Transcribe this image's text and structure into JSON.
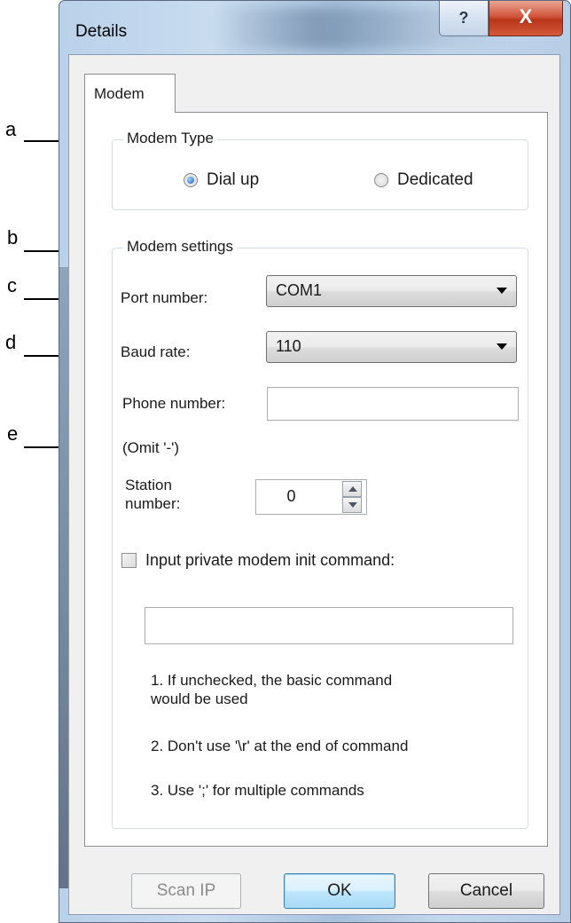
{
  "annotations": [
    "a",
    "b",
    "c",
    "d",
    "e"
  ],
  "window": {
    "title": "Details",
    "help_glyph": "?",
    "close_glyph": "X"
  },
  "tabs": [
    {
      "label": "Modem",
      "selected": true
    }
  ],
  "modem_type": {
    "legend": "Modem Type",
    "options": [
      {
        "label": "Dial up",
        "selected": true
      },
      {
        "label": "Dedicated",
        "selected": false
      }
    ]
  },
  "modem_settings": {
    "legend": "Modem settings",
    "port_label": "Port number:",
    "port_value": "COM1",
    "baud_label": "Baud rate:",
    "baud_value": "110",
    "phone_label": "Phone number:",
    "phone_value": "",
    "omit_hint": "(Omit '-')",
    "station_label_line1": "Station",
    "station_label_line2": "number:",
    "station_value": "0",
    "private_init_label": "Input private modem init command:",
    "private_init_checked": false,
    "private_init_value": "",
    "notes": [
      "1. If unchecked, the basic command",
      "would be used",
      "2. Don't use '\\r' at the end of command",
      "3. Use ';' for multiple commands"
    ]
  },
  "buttons": {
    "scan_ip": "Scan IP",
    "ok": "OK",
    "cancel": "Cancel"
  },
  "colors": {
    "accent": "#3c7fb1",
    "close": "#c8432a",
    "frame": "#b9d1ea"
  }
}
